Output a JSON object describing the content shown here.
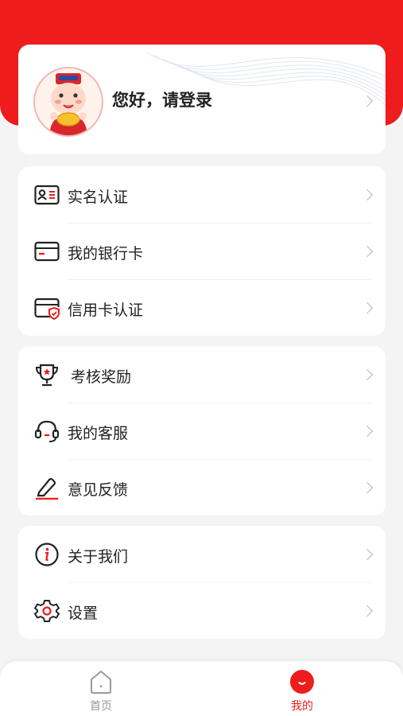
{
  "profile": {
    "greeting": "您好，请登录"
  },
  "groups": [
    [
      {
        "label": "实名认证",
        "icon": "id-card-icon"
      },
      {
        "label": "我的银行卡",
        "icon": "bank-card-icon"
      },
      {
        "label": "信用卡认证",
        "icon": "credit-card-shield-icon"
      }
    ],
    [
      {
        "label": "考核奖励",
        "icon": "trophy-icon"
      },
      {
        "label": "我的客服",
        "icon": "headset-icon"
      },
      {
        "label": "意见反馈",
        "icon": "pencil-icon"
      }
    ],
    [
      {
        "label": "关于我们",
        "icon": "info-icon"
      },
      {
        "label": "设置",
        "icon": "gear-icon"
      }
    ]
  ],
  "tabbar": {
    "home": {
      "label": "首页",
      "icon": "home-icon"
    },
    "mine": {
      "label": "我的",
      "icon": "smile-icon",
      "active": true
    }
  },
  "colors": {
    "accent": "#ee1c1c",
    "tab_inactive": "#999999",
    "background": "#f4f4f5"
  }
}
